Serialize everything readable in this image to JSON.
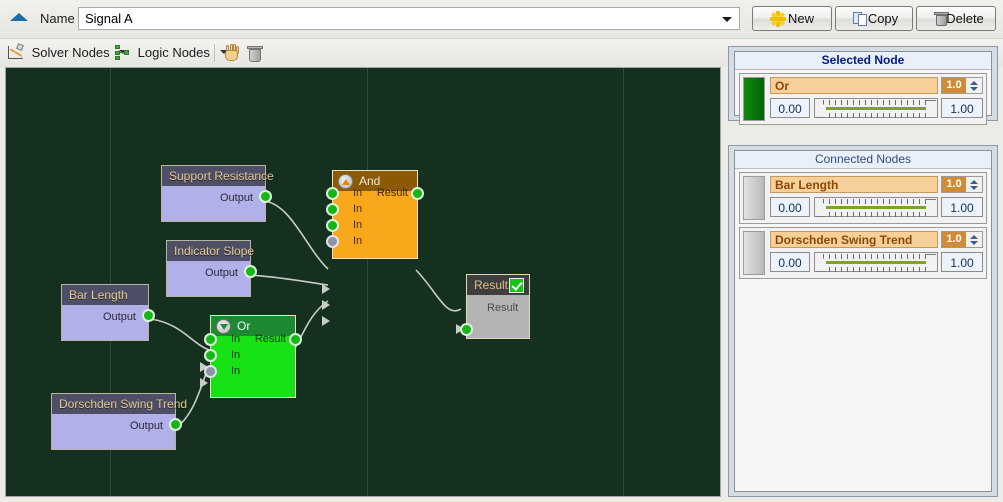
{
  "window": {
    "name_label": "Name",
    "name_value": "Signal A"
  },
  "toolbar_buttons": {
    "new": "New",
    "copy": "Copy",
    "delete": "Delete"
  },
  "toolstrip": {
    "solver_nodes": "Solver Nodes",
    "logic_nodes": "Logic Nodes"
  },
  "canvas": {
    "nodes": [
      {
        "title": "Support Resistance",
        "output_label": "Output"
      },
      {
        "title": "Indicator Slope",
        "output_label": "Output"
      },
      {
        "title": "Bar Length",
        "output_label": "Output"
      },
      {
        "title": "Dorschden Swing Trend",
        "output_label": "Output"
      }
    ],
    "and_node": {
      "title": "And",
      "in_labels": [
        "In",
        "In",
        "In",
        "In"
      ],
      "result_label": "Result"
    },
    "or_node": {
      "title": "Or",
      "in_labels": [
        "In",
        "In",
        "In"
      ],
      "result_label": "Result"
    },
    "result_node": {
      "title": "Result",
      "port_label": "Result"
    }
  },
  "right_panel": {
    "selected_title": "Selected Node",
    "connected_title": "Connected Nodes",
    "selected": {
      "name": "Or",
      "weight": "1.0",
      "min": "0.00",
      "max": "1.00"
    },
    "connected": [
      {
        "name": "Bar Length",
        "weight": "1.0",
        "min": "0.00",
        "max": "1.00"
      },
      {
        "name": "Dorschden Swing Trend",
        "weight": "1.0",
        "min": "0.00",
        "max": "1.00"
      }
    ]
  }
}
